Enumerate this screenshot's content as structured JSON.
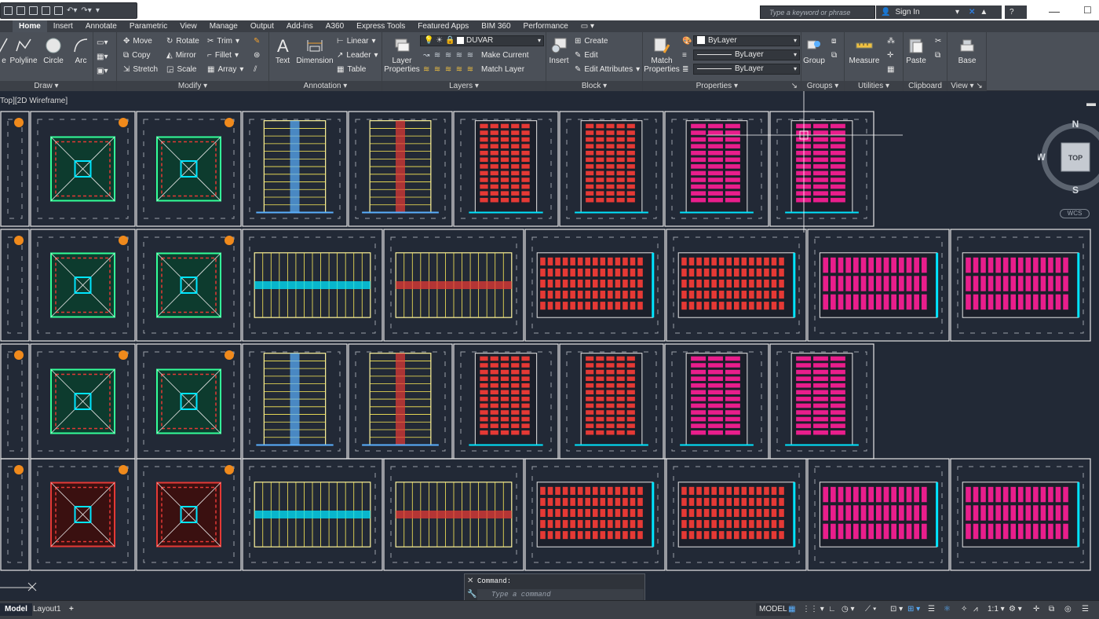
{
  "search": {
    "placeholder": "Type a keyword or phrase"
  },
  "account": {
    "sign_in": "Sign In"
  },
  "tabs": [
    "Home",
    "Insert",
    "Annotate",
    "Parametric",
    "View",
    "Manage",
    "Output",
    "Add-ins",
    "A360",
    "Express Tools",
    "Featured Apps",
    "BIM 360",
    "Performance"
  ],
  "panels": {
    "draw": {
      "title": "Draw",
      "polyline": "Polyline",
      "circle": "Circle",
      "arc": "Arc"
    },
    "modify": {
      "title": "Modify",
      "move": "Move",
      "rotate": "Rotate",
      "trim": "Trim",
      "copy": "Copy",
      "mirror": "Mirror",
      "fillet": "Fillet",
      "stretch": "Stretch",
      "scale": "Scale",
      "array": "Array"
    },
    "annotation": {
      "title": "Annotation",
      "text": "Text",
      "dimension": "Dimension",
      "linear": "Linear",
      "leader": "Leader",
      "table": "Table"
    },
    "layers": {
      "title": "Layers",
      "layer_properties": "Layer Properties",
      "current_layer": "DUVAR",
      "make_current": "Make Current",
      "match_layer": "Match Layer"
    },
    "block": {
      "title": "Block",
      "insert": "Insert",
      "create": "Create",
      "edit": "Edit",
      "edit_attributes": "Edit Attributes"
    },
    "properties": {
      "title": "Properties",
      "match_properties": "Match Properties",
      "color": "ByLayer",
      "linetype": "ByLayer",
      "lineweight": "ByLayer"
    },
    "groups": {
      "title": "Groups",
      "group": "Group"
    },
    "utilities": {
      "title": "Utilities",
      "measure": "Measure"
    },
    "clipboard": {
      "title": "Clipboard",
      "paste": "Paste"
    },
    "view": {
      "title": "View",
      "base": "Base"
    }
  },
  "viewport": {
    "label": "Top][2D Wireframe]"
  },
  "viewcube": {
    "north": "N",
    "south": "S",
    "west": "W",
    "face": "TOP",
    "wcs": "WCS"
  },
  "command": {
    "history": "Command:",
    "placeholder": "Type a command"
  },
  "layouts": {
    "model": "Model",
    "layout1": "Layout1",
    "add": "+"
  },
  "status": {
    "model": "MODEL",
    "scale": "1:1"
  },
  "colors": {
    "background": "#222936",
    "panel": "#4b5058",
    "accent_red": "#e53935",
    "accent_magenta": "#e91e8c",
    "accent_cyan": "#00e5ff",
    "accent_yellow": "#ffee58"
  }
}
